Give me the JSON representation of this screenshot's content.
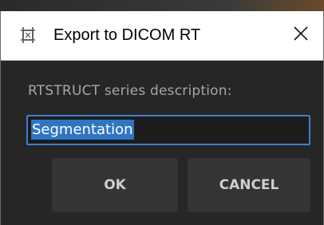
{
  "dialog": {
    "title": "Export to DICOM RT",
    "title_icon": "export-crop-icon",
    "close_icon": "close-icon"
  },
  "form": {
    "label": "RTSTRUCT series description:",
    "value": "Segmentation"
  },
  "buttons": {
    "ok_label": "OK",
    "cancel_label": "CANCEL"
  },
  "colors": {
    "accent_border": "#3f80c8",
    "selection": "#2f75c4",
    "background": "#262626",
    "button": "#343434"
  }
}
